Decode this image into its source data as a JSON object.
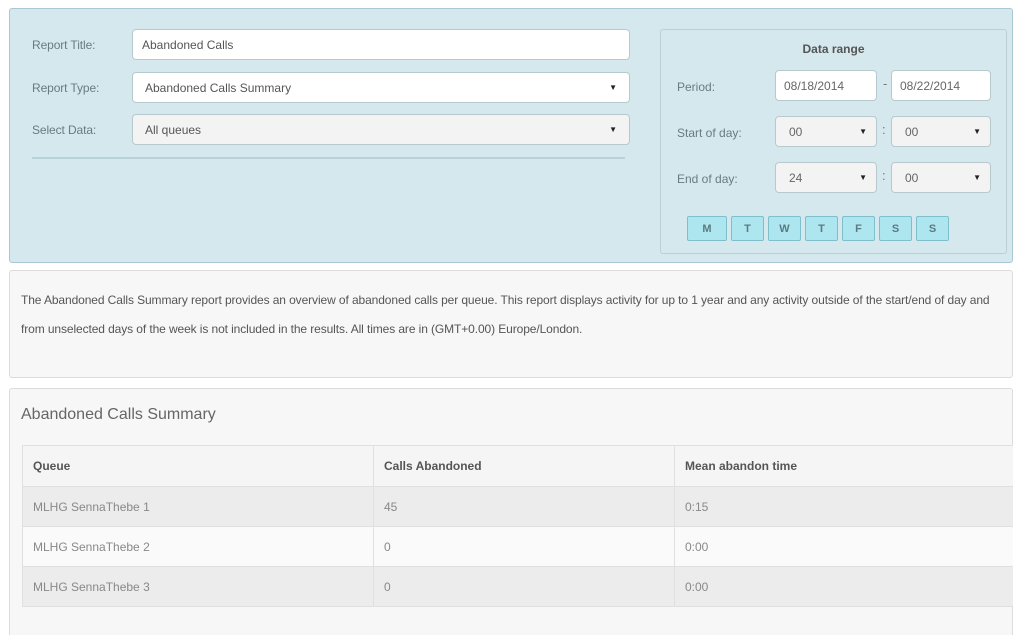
{
  "form": {
    "report_title_label": "Report Title:",
    "report_title_value": "Abandoned Calls",
    "report_type_label": "Report Type:",
    "report_type_value": "Abandoned Calls Summary",
    "select_data_label": "Select Data:",
    "select_data_value": "All queues"
  },
  "range": {
    "title": "Data range",
    "period_label": "Period:",
    "period_start": "08/18/2014",
    "period_separator": "-",
    "period_end": "08/22/2014",
    "start_label": "Start of day:",
    "start_hour": "00",
    "start_minute": "00",
    "end_label": "End of day:",
    "end_hour": "24",
    "end_minute": "00",
    "time_separator": ":",
    "days": [
      "M",
      "T",
      "W",
      "T",
      "F",
      "S",
      "S"
    ]
  },
  "description": {
    "text": "The Abandoned Calls Summary report provides an overview of abandoned calls per queue. This report displays activity for up to 1 year and any activity outside of the start/end of day and from unselected days of the week is not included in the results. All times are in (GMT+0.00) Europe/London."
  },
  "summary": {
    "title": "Abandoned Calls Summary",
    "columns": [
      "Queue",
      "Calls Abandoned",
      "Mean abandon time"
    ],
    "rows": [
      [
        "MLHG SennaThebe 1",
        "45",
        "0:15"
      ],
      [
        "MLHG SennaThebe 2",
        "0",
        "0:00"
      ],
      [
        "MLHG SennaThebe 3",
        "0",
        "0:00"
      ]
    ]
  },
  "icons": {
    "dropdown_caret": "▼"
  }
}
